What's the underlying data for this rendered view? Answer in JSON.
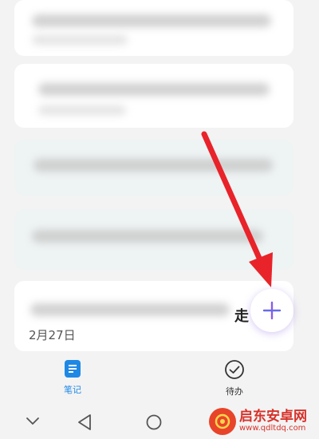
{
  "notes": {
    "last_card": {
      "visible_text": "走",
      "date": "2月27日"
    }
  },
  "fab": {
    "icon": "plus-icon"
  },
  "tabs": [
    {
      "label": "笔记",
      "icon": "note-icon",
      "active": true
    },
    {
      "label": "待办",
      "icon": "check-circle-icon",
      "active": false
    }
  ],
  "nav": {
    "icons": [
      "chevron-down-icon",
      "back-triangle-icon",
      "home-circle-icon"
    ]
  },
  "watermark": {
    "cn": "启东安卓网",
    "url": "www.qdltdq.com"
  },
  "colors": {
    "accent": "#1e88e5",
    "fab_plus": "#8a5ce6",
    "arrow": "#e8232a",
    "watermark": "#d7322a"
  }
}
